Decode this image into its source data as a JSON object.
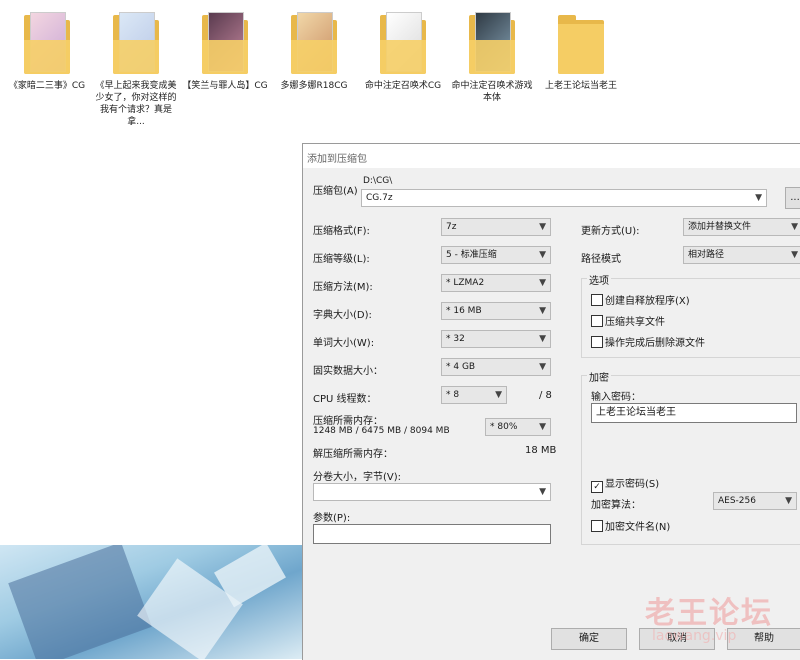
{
  "folders": [
    {
      "name": "《家暗二三事》CG"
    },
    {
      "name": "《早上起来我变成美少女了，你对这样的我有个请求？真是拿..."
    },
    {
      "name": "【笑兰与罪人岛】CG"
    },
    {
      "name": "多娜多娜R18CG"
    },
    {
      "name": "命中注定召唤术CG"
    },
    {
      "name": "命中注定召唤术游戏本体"
    },
    {
      "name": "上老王论坛当老王"
    }
  ],
  "dialog": {
    "title": "添加到压缩包",
    "archive_label": "压缩包(A)",
    "archive_path": "D:\\CG\\",
    "archive_name": "CG.7z",
    "browse_label": "...",
    "format_label": "压缩格式(F):",
    "format_value": "7z",
    "level_label": "压缩等级(L):",
    "level_value": "5 - 标准压缩",
    "method_label": "压缩方法(M):",
    "method_value": "* LZMA2",
    "dict_label": "字典大小(D):",
    "dict_value": "* 16 MB",
    "word_label": "单词大小(W):",
    "word_value": "* 32",
    "solid_label": "固实数据大小：",
    "solid_value": "* 4 GB",
    "cpu_label": "CPU 线程数：",
    "cpu_value": "* 8",
    "cpu_total": "/ 8",
    "mem_label": "压缩所需内存：",
    "mem_detail": "1248 MB / 6475 MB / 8094 MB",
    "mem_pct": "* 80%",
    "decomp_label": "解压缩所需内存：",
    "decomp_value": "18 MB",
    "split_label": "分卷大小，字节(V):",
    "split_value": "",
    "params_label": "参数(P):",
    "params_value": "",
    "update_label": "更新方式(U):",
    "update_value": "添加并替换文件",
    "pathmode_label": "路径模式",
    "pathmode_value": "相对路径",
    "options_title": "选项",
    "opt_sfx": "创建自释放程序(X)",
    "opt_shared": "压缩共享文件",
    "opt_delete": "操作完成后删除源文件",
    "encrypt_title": "加密",
    "password_label": "输入密码：",
    "password_value": "上老王论坛当老王",
    "show_pw": "显示密码(S)",
    "show_pw_check": "✓",
    "enc_method_label": "加密算法：",
    "enc_method_value": "AES-256",
    "enc_names": "加密文件名(N)",
    "ok": "确定",
    "cancel": "取消",
    "help": "帮助"
  },
  "watermark": {
    "text": "老王论坛",
    "sub": "laowang.vip"
  }
}
